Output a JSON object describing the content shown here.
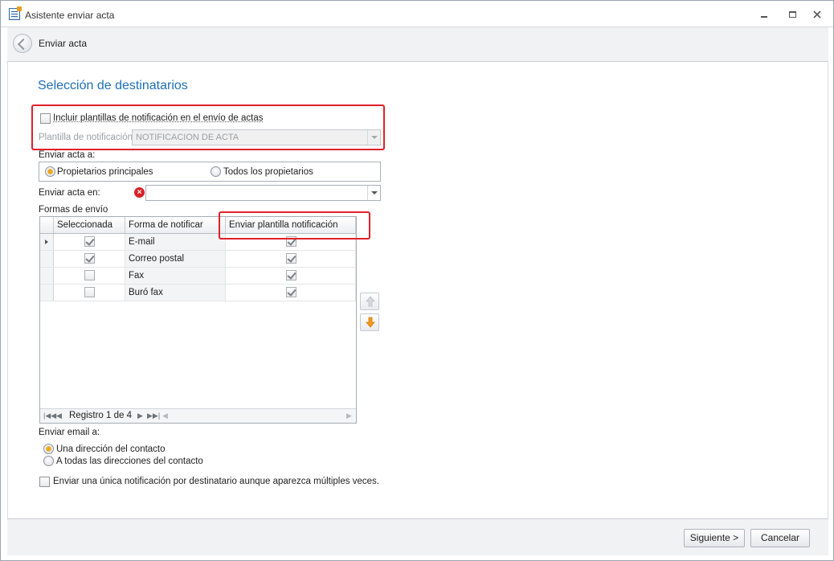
{
  "window": {
    "title": "Asistente enviar acta"
  },
  "header": {
    "title": "Enviar acta"
  },
  "section_title": "Selección de destinatarios",
  "include_templates": {
    "label": "Incluir plantillas de notificación en el envío de actas",
    "checked": false
  },
  "template_field": {
    "label": "Plantilla de notificación:",
    "value": "NOTIFICACION DE ACTA"
  },
  "send_to": {
    "label": "Enviar acta a:",
    "options": [
      "Propietarios principales",
      "Todos los propietarios"
    ],
    "selected": "Propietarios principales"
  },
  "send_in": {
    "label": "Enviar acta en:",
    "value": ""
  },
  "methods": {
    "label": "Formas de envío",
    "columns": [
      "Seleccionada",
      "Forma de notificar",
      "Enviar plantilla notificación"
    ],
    "rows": [
      {
        "selected": true,
        "method": "E-mail",
        "send_template": true
      },
      {
        "selected": true,
        "method": "Correo postal",
        "send_template": true
      },
      {
        "selected": false,
        "method": "Fax",
        "send_template": true
      },
      {
        "selected": false,
        "method": "Buró fax",
        "send_template": true
      }
    ],
    "navigator": "Registro 1 de 4"
  },
  "email_to": {
    "label": "Enviar email a:",
    "options": [
      "Una dirección del contacto",
      "A todas las direcciones del contacto"
    ],
    "selected": "Una dirección del contacto"
  },
  "single_notification": {
    "label": "Enviar una única notificación por destinatario aunque aparezca múltiples veces.",
    "checked": false
  },
  "footer": {
    "next_label": "Siguiente >",
    "cancel_label": "Cancelar"
  }
}
